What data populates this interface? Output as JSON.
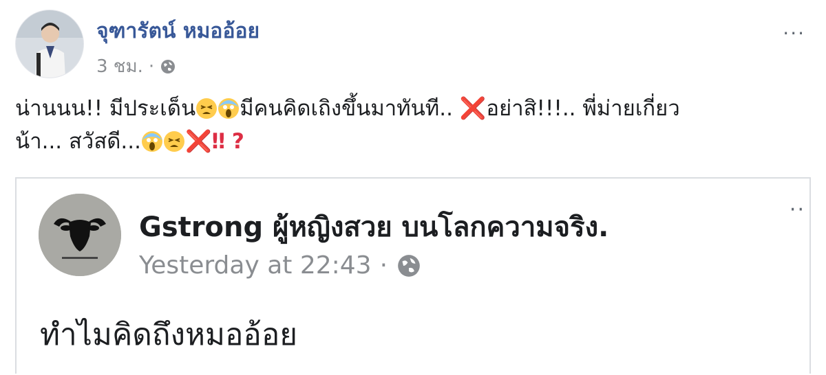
{
  "post": {
    "author": "จุฑารัตน์ หมออ้อย",
    "time": "3 ชม.",
    "dot": "·",
    "more": "···",
    "line1_a": "น่านนน!! มีประเด็น",
    "line1_b": "มีคนคิดเถิงขึ้นมาทันที.. ",
    "line1_x": "❌",
    "line1_c": "อย่าสิ!!!.. พี่ม่ายเกี่ยว",
    "line2_a": "น้า... สวัสดี...",
    "line2_x": "❌",
    "line2_bang": "‼",
    "line2_q": "?"
  },
  "shared": {
    "author": "Gstrong ผู้หญิงสวย บนโลกความจริง.",
    "time": "Yesterday at 22:43",
    "dot": "·",
    "more": "··",
    "text": "ทำไมคิดถึงหมออ้อย"
  },
  "colors": {
    "author_link": "#385898",
    "meta_gray": "#8a8d91",
    "emoji_red": "#dd2e44",
    "card_border": "#dadde1"
  },
  "icons": [
    "globe-icon",
    "more-options-icon",
    "tired-face-emoji",
    "screaming-face-emoji",
    "cross-mark-emoji"
  ]
}
